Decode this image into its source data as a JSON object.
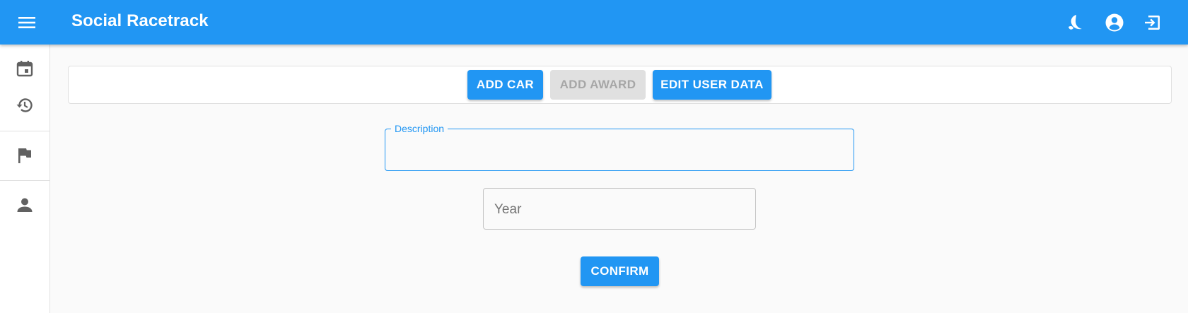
{
  "appbar": {
    "title": "Social Racetrack",
    "menu_icon": "menu-icon",
    "actions": [
      "moon-theme-icon",
      "account-circle-icon",
      "logout-icon"
    ],
    "color": "#2196f3"
  },
  "sidebar": {
    "items": [
      {
        "icon": "calendar-icon"
      },
      {
        "icon": "history-icon"
      },
      {
        "icon": "flag-icon"
      },
      {
        "icon": "person-icon"
      }
    ]
  },
  "toolbar": {
    "add_car_label": "ADD CAR",
    "add_award_label": "ADD AWARD",
    "edit_user_data_label": "EDIT USER DATA"
  },
  "form": {
    "description": {
      "label": "Description",
      "value": ""
    },
    "year": {
      "placeholder": "Year",
      "value": ""
    },
    "confirm_label": "CONFIRM"
  }
}
